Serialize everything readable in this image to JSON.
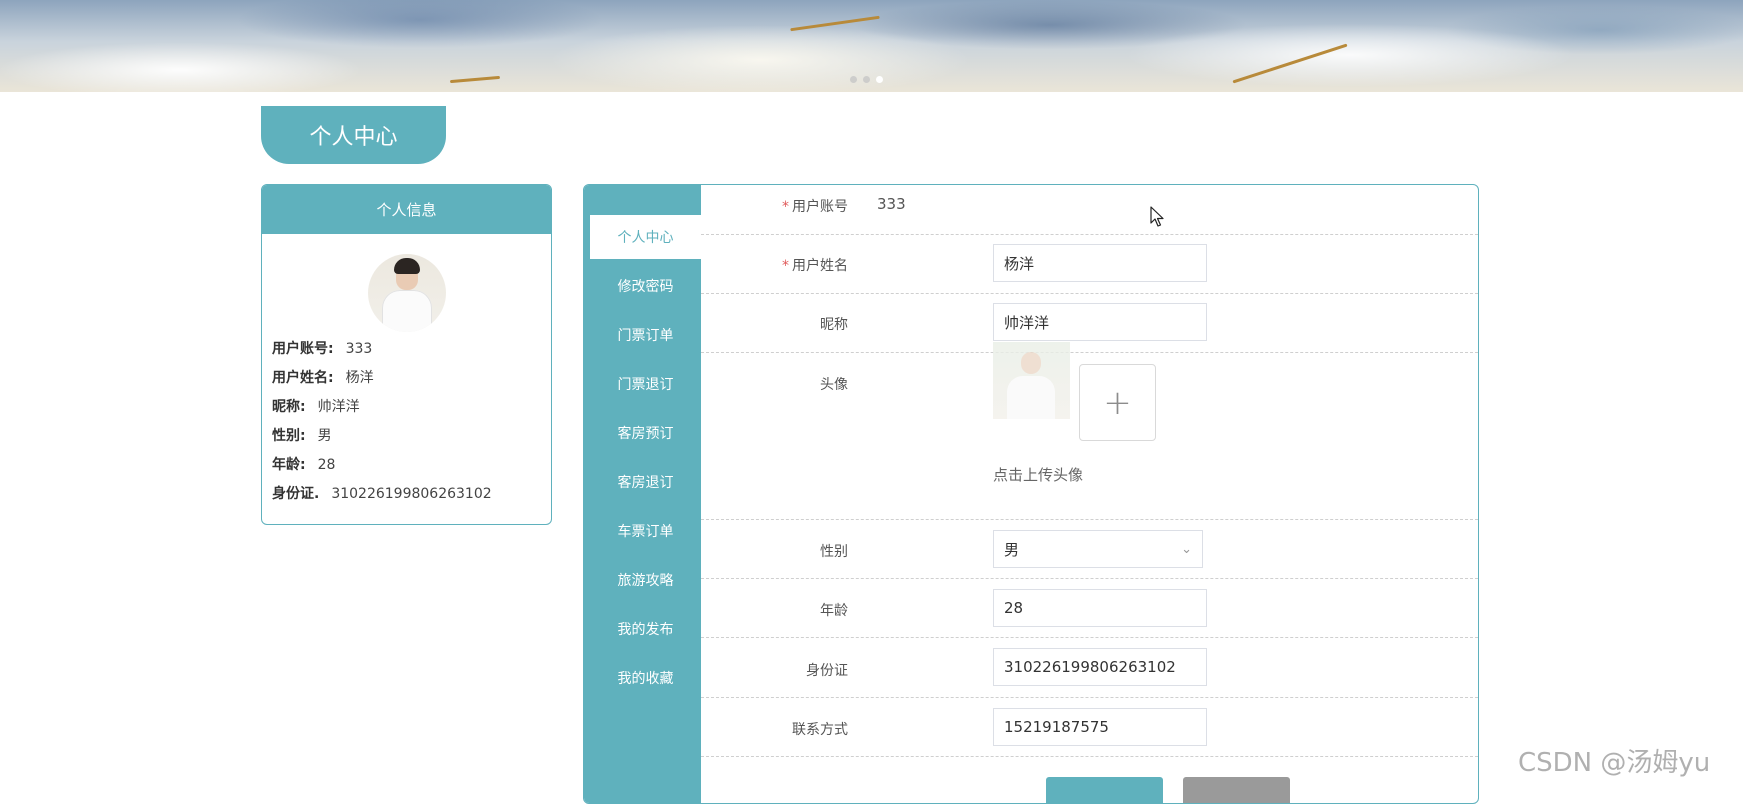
{
  "banner": {
    "dots_count": 3,
    "active_dot": 3
  },
  "page_tab": {
    "title": "个人中心"
  },
  "info_card": {
    "title": "个人信息",
    "rows": [
      {
        "label": "用户账号:",
        "value": "333"
      },
      {
        "label": "用户姓名:",
        "value": "杨洋"
      },
      {
        "label": "昵称:",
        "value": "帅洋洋"
      },
      {
        "label": "性别:",
        "value": "男"
      },
      {
        "label": "年龄:",
        "value": "28"
      },
      {
        "label": "身份证.",
        "value": "310226199806263102"
      }
    ]
  },
  "menu": {
    "active_index": 0,
    "items": [
      "个人中心",
      "修改密码",
      "门票订单",
      "门票退订",
      "客房预订",
      "客房退订",
      "车票订单",
      "旅游攻略",
      "我的发布",
      "我的收藏"
    ]
  },
  "form": {
    "account": {
      "label": "用户账号",
      "value": "333",
      "required": true
    },
    "name": {
      "label": "用户姓名",
      "value": "杨洋",
      "required": true
    },
    "nickname": {
      "label": "昵称",
      "value": "帅洋洋"
    },
    "avatar": {
      "label": "头像",
      "upload_symbol": "+",
      "hint": "点击上传头像"
    },
    "gender": {
      "label": "性别",
      "value": "男"
    },
    "age": {
      "label": "年龄",
      "value": "28"
    },
    "id_card": {
      "label": "身份证",
      "value": "310226199806263102"
    },
    "contact": {
      "label": "联系方式",
      "value": "15219187575"
    }
  },
  "colors": {
    "accent": "#5fb1bd",
    "required": "#e05a5a",
    "secondary_button": "#9a9a9a"
  },
  "watermark": "CSDN @汤姆yu"
}
